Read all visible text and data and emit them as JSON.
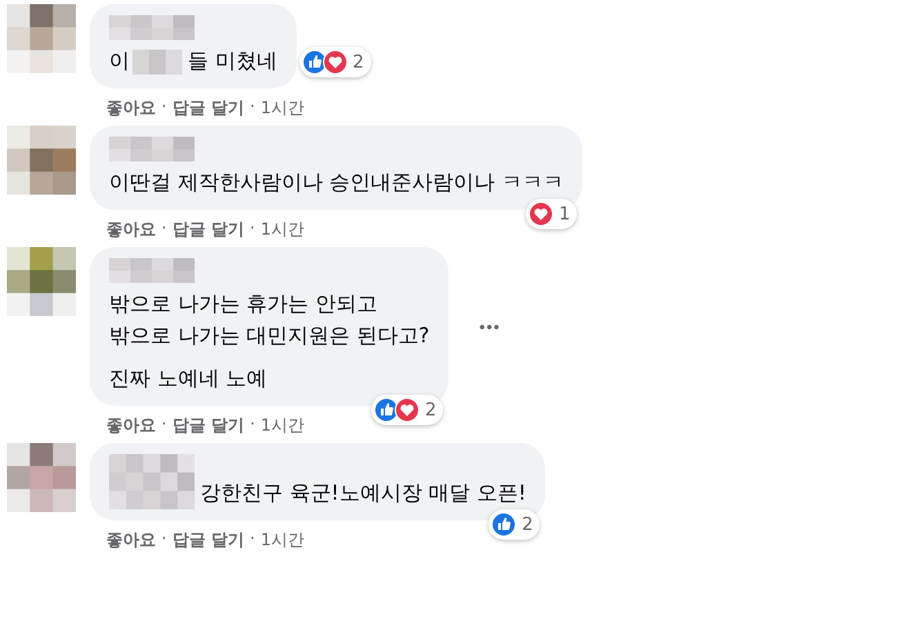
{
  "comments": [
    {
      "name_redacted": true,
      "lines": [
        [
          {
            "kind": "text",
            "text": "이"
          },
          {
            "kind": "redacted"
          },
          {
            "kind": "text",
            "text": "들 미쳤네"
          }
        ]
      ],
      "reactions": {
        "types": [
          {
            "kind": "like"
          },
          {
            "kind": "love"
          }
        ],
        "count": "2"
      },
      "actions": [
        {
          "kind": "link",
          "text": "좋아요"
        },
        {
          "kind": "sep",
          "text": "·"
        },
        {
          "kind": "link",
          "text": "답글 달기"
        },
        {
          "kind": "sep",
          "text": "·"
        },
        {
          "kind": "time",
          "text": "1시간"
        }
      ]
    },
    {
      "name_redacted": true,
      "lines": [
        [
          {
            "kind": "text",
            "text": "이딴걸 제작한사람이나 승인내준사람이나 ㅋㅋㅋ"
          }
        ]
      ],
      "reactions": {
        "types": [
          {
            "kind": "love"
          }
        ],
        "count": "1"
      },
      "actions": [
        {
          "kind": "link",
          "text": "좋아요"
        },
        {
          "kind": "sep",
          "text": "·"
        },
        {
          "kind": "link",
          "text": "답글 달기"
        },
        {
          "kind": "sep",
          "text": "·"
        },
        {
          "kind": "time",
          "text": "1시간"
        }
      ]
    },
    {
      "name_redacted": true,
      "lines": [
        [
          {
            "kind": "text",
            "text": "밖으로 나가는 휴가는 안되고"
          }
        ],
        [
          {
            "kind": "text",
            "text": "밖으로 나가는 대민지원은 된다고?"
          }
        ],
        [
          {
            "kind": "gap"
          }
        ],
        [
          {
            "kind": "text",
            "text": "진짜 노예네 노예"
          }
        ]
      ],
      "menu": "•••",
      "reactions": {
        "types": [
          {
            "kind": "like"
          },
          {
            "kind": "love"
          }
        ],
        "count": "2"
      },
      "actions": [
        {
          "kind": "link",
          "text": "좋아요"
        },
        {
          "kind": "sep",
          "text": "·"
        },
        {
          "kind": "link",
          "text": "답글 달기"
        },
        {
          "kind": "sep",
          "text": "·"
        },
        {
          "kind": "time",
          "text": "1시간"
        }
      ]
    },
    {
      "name_redacted": false,
      "lines": [
        [
          {
            "kind": "redacted"
          },
          {
            "kind": "text",
            "text": "강한친구 육군!노예시장 매달 오픈!"
          }
        ]
      ],
      "reactions": {
        "types": [
          {
            "kind": "like"
          }
        ],
        "count": "2"
      },
      "actions": [
        {
          "kind": "link",
          "text": "좋아요"
        },
        {
          "kind": "sep",
          "text": "·"
        },
        {
          "kind": "link",
          "text": "답글 달기"
        },
        {
          "kind": "sep",
          "text": "·"
        },
        {
          "kind": "time",
          "text": "1시간"
        }
      ]
    }
  ]
}
